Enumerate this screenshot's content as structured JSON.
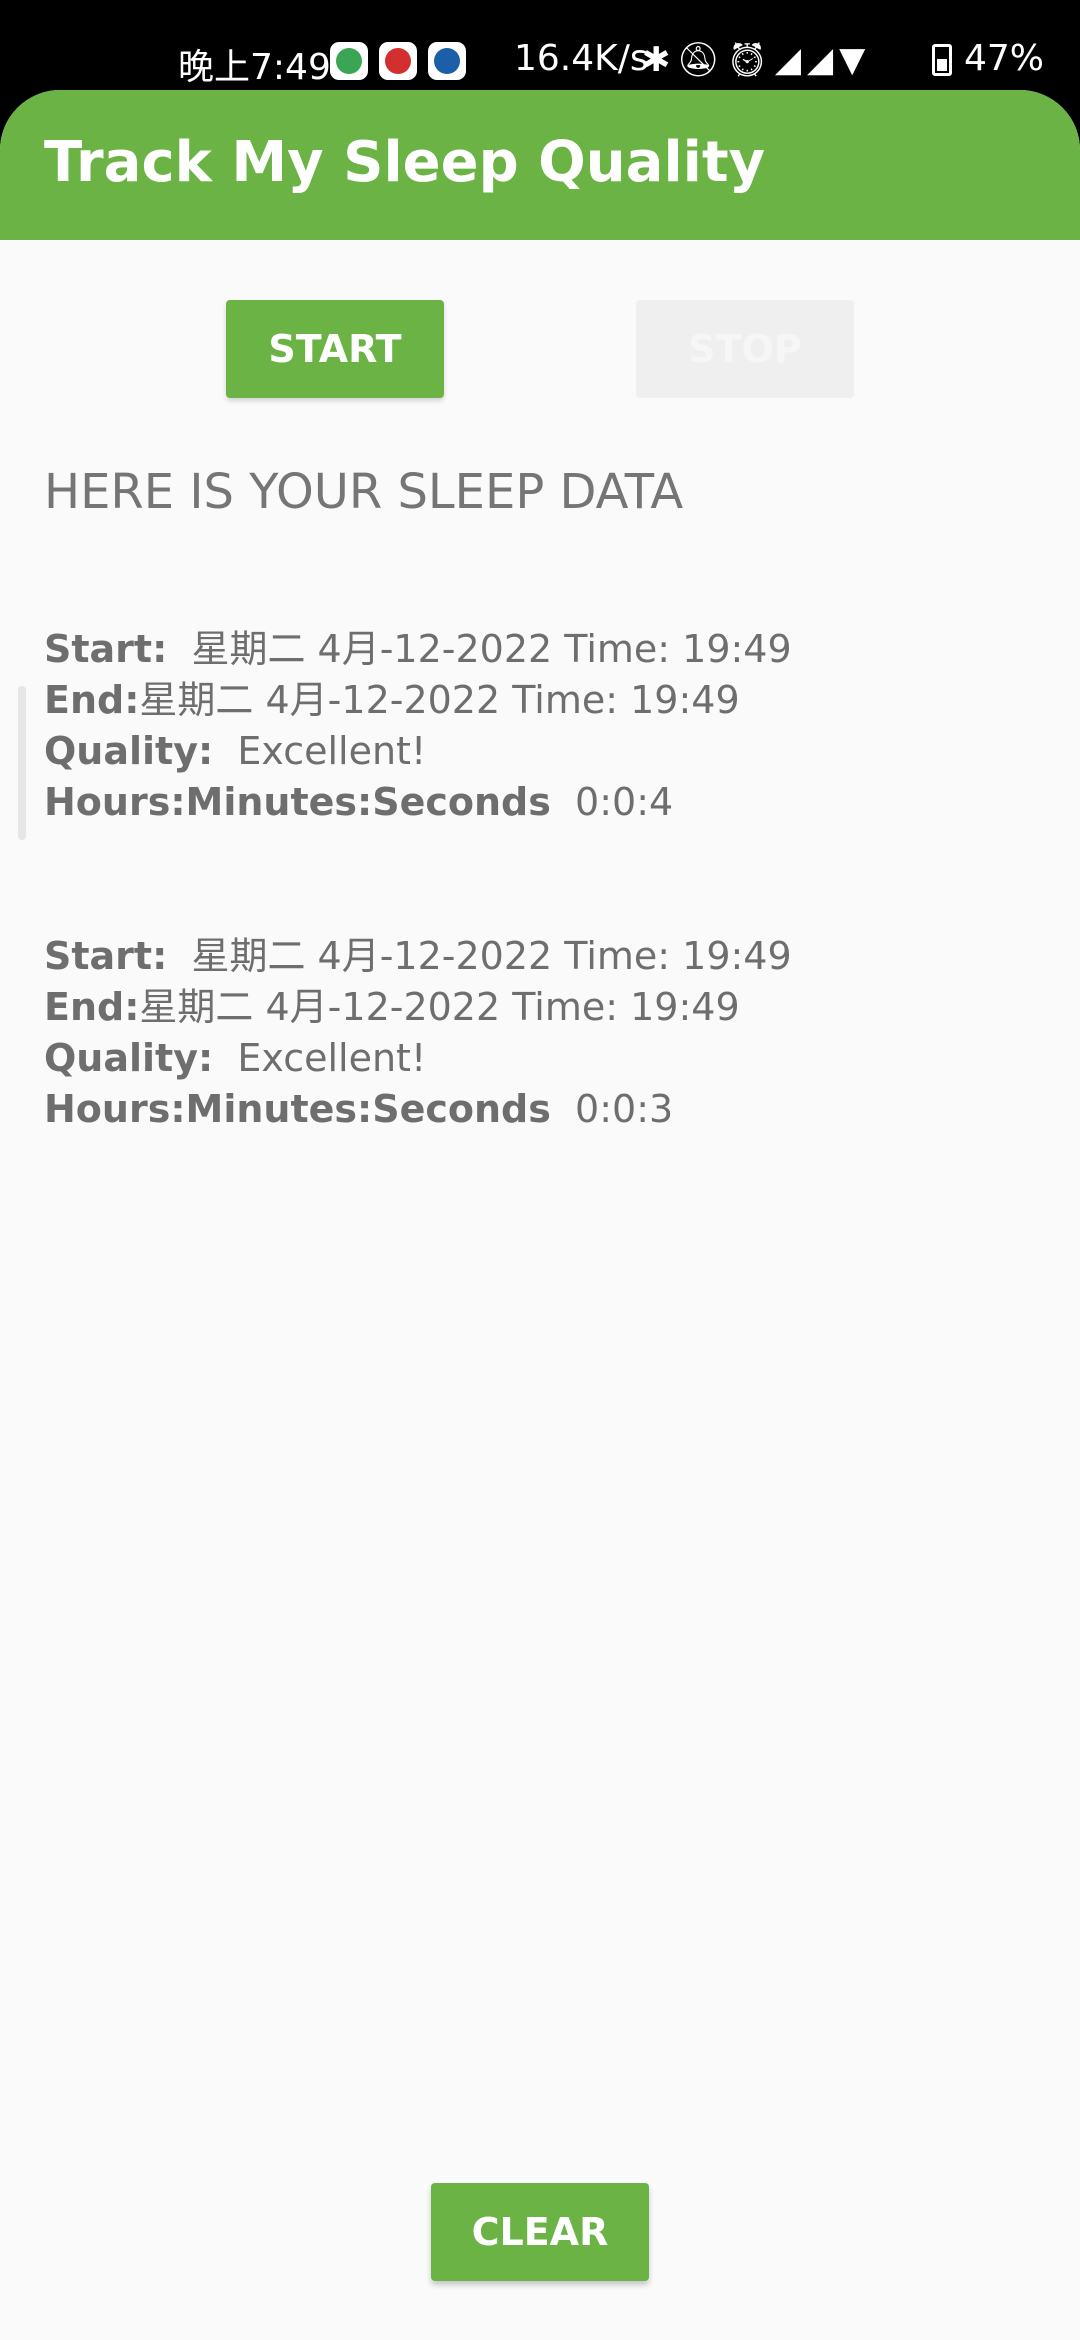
{
  "status_bar": {
    "time": "晚上7:49",
    "speed": "16.4K/s",
    "battery": "47%",
    "icons": [
      "app-icon-green",
      "app-icon-red",
      "app-icon-blue",
      "bluetooth-icon",
      "bell-off-icon",
      "alarm-icon",
      "hd-signal-icon",
      "hd-signal-icon",
      "wifi-icon",
      "battery-icon"
    ]
  },
  "toolbar": {
    "title": "Track My Sleep Quality"
  },
  "buttons": {
    "start": "START",
    "stop": "STOP",
    "clear": "CLEAR"
  },
  "heading": "HERE IS YOUR SLEEP DATA",
  "labels": {
    "start": "Start:",
    "end": "End:",
    "quality": "Quality:",
    "duration": "Hours:Minutes:Seconds"
  },
  "records": [
    {
      "start": "星期二 4月-12-2022 Time: 19:49",
      "end": "星期二 4月-12-2022 Time: 19:49",
      "quality": "Excellent!",
      "duration": "0:0:4"
    },
    {
      "start": "星期二 4月-12-2022 Time: 19:49",
      "end": "星期二 4月-12-2022 Time: 19:49",
      "quality": "Excellent!",
      "duration": "0:0:3"
    }
  ],
  "colors": {
    "accent": "#6ab344",
    "background": "#fafafa",
    "text": "#6e6e6e",
    "disabled_button": "#efefef"
  }
}
